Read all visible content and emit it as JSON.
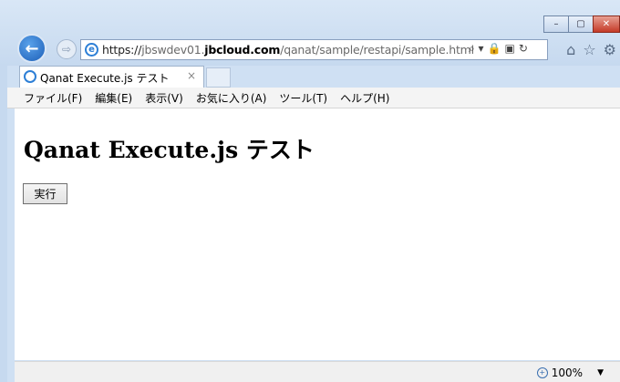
{
  "window": {
    "controls": {
      "minimize": "–",
      "maximize": "▢",
      "close": "✕"
    }
  },
  "nav": {
    "back_icon": "←",
    "forward_icon": "⇨",
    "url_prefix": "https://",
    "url_subdomain": "jbswdev01.",
    "url_domain": "jbcloud.com",
    "url_path": "/qanat/sample/restapi/sample.html",
    "addr_tools": [
      "⌕ ▾",
      "🔒",
      "▣",
      "↻"
    ],
    "toolbar_icons": [
      "⌂",
      "☆",
      "⚙"
    ]
  },
  "tab": {
    "title": "Qanat Execute.js テスト",
    "close": "×"
  },
  "menu": [
    "ファイル(F)",
    "編集(E)",
    "表示(V)",
    "お気に入り(A)",
    "ツール(T)",
    "ヘルプ(H)"
  ],
  "page": {
    "heading": "Qanat Execute.js テスト",
    "execute_button": "実行"
  },
  "status": {
    "zoom": "100%",
    "zoom_caret": "▼"
  }
}
